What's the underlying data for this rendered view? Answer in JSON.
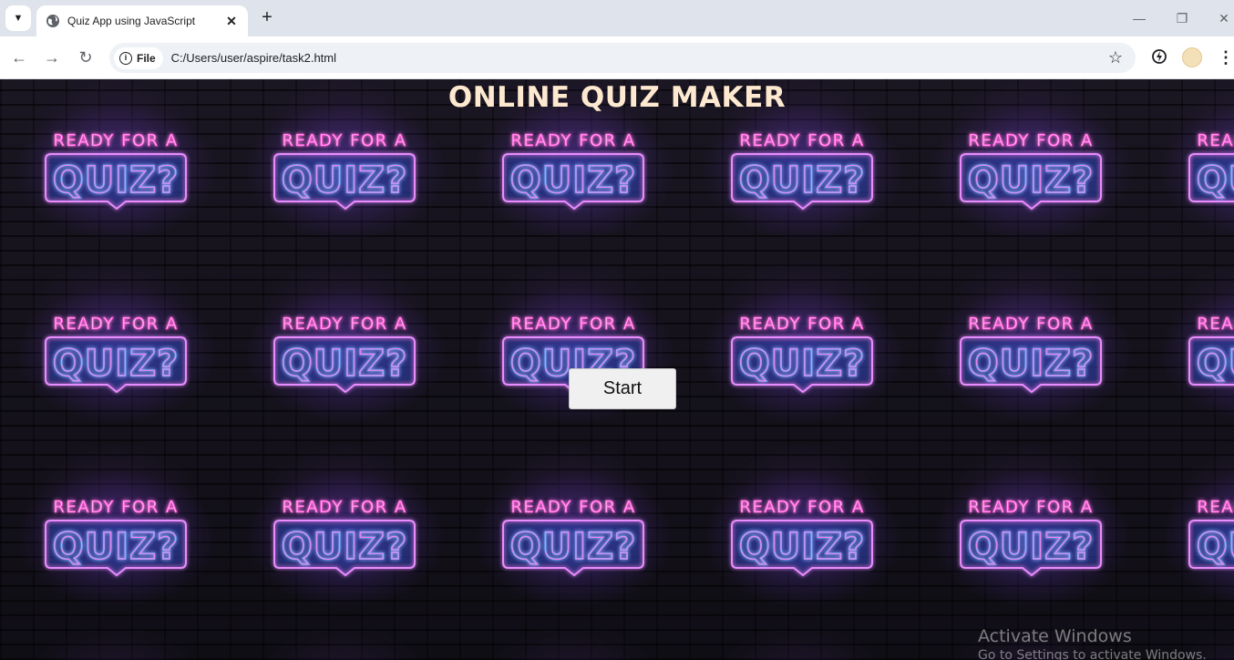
{
  "browser": {
    "tab_title": "Quiz App using JavaScript",
    "tab_close": "✕",
    "new_tab": "+",
    "site_chip": "File",
    "url": "C:/Users/user/aspire/task2.html"
  },
  "page": {
    "title": "ONLINE QUIZ MAKER",
    "start_label": "Start",
    "neon_line1": "READY FOR A",
    "neon_line2": "QUIZ?"
  },
  "watermark": {
    "line1": "Activate Windows",
    "line2": "Go to Settings to activate Windows."
  },
  "colors": {
    "neon_pink": "#ff4fd8",
    "neon_blue": "#4fb6ff",
    "title": "#fde9cf"
  }
}
